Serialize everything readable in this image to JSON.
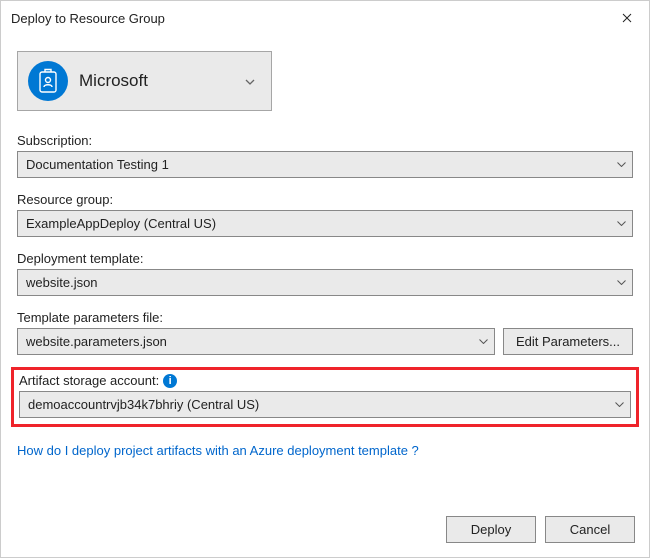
{
  "window": {
    "title": "Deploy to Resource Group"
  },
  "account": {
    "name": "Microsoft"
  },
  "fields": {
    "subscription": {
      "label": "Subscription:",
      "value": "Documentation Testing 1"
    },
    "resourceGroup": {
      "label": "Resource group:",
      "value": "ExampleAppDeploy (Central US)"
    },
    "deployTemplate": {
      "label": "Deployment template:",
      "value": "website.json"
    },
    "paramsFile": {
      "label": "Template parameters file:",
      "value": "website.parameters.json",
      "editBtn": "Edit Parameters..."
    },
    "artifact": {
      "label": "Artifact storage account:",
      "value": "demoaccountrvjb34k7bhriy (Central US)"
    }
  },
  "helpLink": "How do I deploy project artifacts with an Azure deployment template ?",
  "footer": {
    "deploy": "Deploy",
    "cancel": "Cancel"
  }
}
